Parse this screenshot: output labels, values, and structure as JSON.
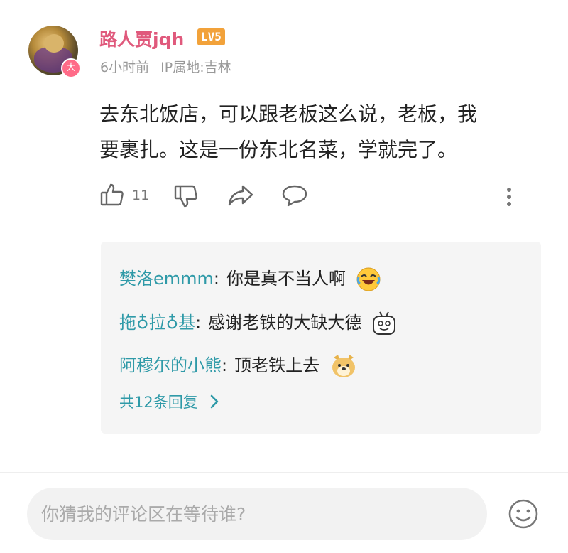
{
  "comment": {
    "username": "路人贾jqh",
    "level": "LV5",
    "avatar_badge": "大",
    "time": "6小时前",
    "ip": "IP属地:吉林",
    "text_line1": "去东北饭店，可以跟老板这么说，老板，我",
    "text_line2": "要裹扎。这是一份东北名菜，学就完了。",
    "likes": "11"
  },
  "replies": [
    {
      "name": "樊洛emmm",
      "text": "你是真不当人啊",
      "emoji": "laugh-cry-emoji"
    },
    {
      "name": "拖♁拉♁基",
      "text": "感谢老铁的大缺大德",
      "emoji": "tv-face-emoji"
    },
    {
      "name": "阿穆尔的小熊",
      "text": "顶老铁上去",
      "emoji": "doge-emoji"
    }
  ],
  "more_replies_label": "共12条回复",
  "input": {
    "placeholder": "你猜我的评论区在等待谁?"
  },
  "icons": [
    "like-icon",
    "dislike-icon",
    "share-icon",
    "comment-icon",
    "more-icon",
    "emoji-icon"
  ]
}
